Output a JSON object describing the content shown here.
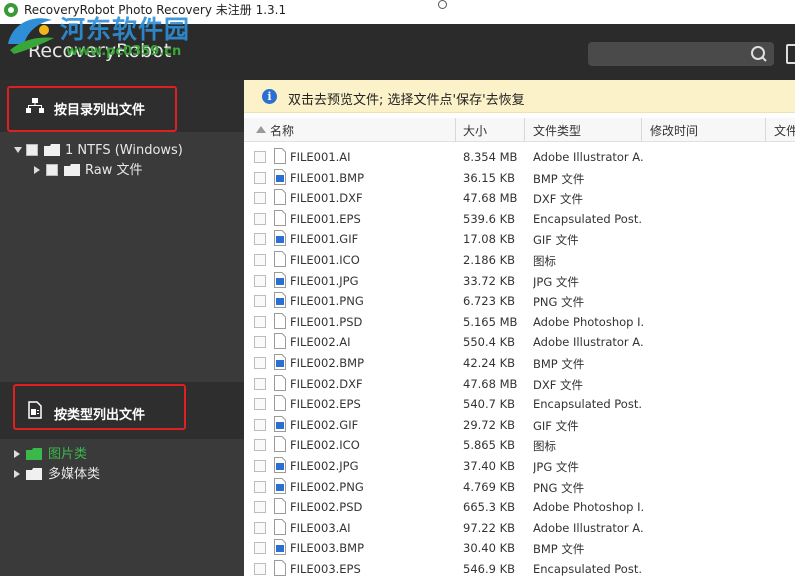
{
  "window": {
    "title": "RecoveryRobot Photo Recovery 未注册 1.3.1"
  },
  "watermark": {
    "text_cn": "河东软件园",
    "text_url": "www.pc0359.cn"
  },
  "header": {
    "brand": "RecoveryRobot",
    "search_placeholder": ""
  },
  "sidebar": {
    "by_directory_label": "按目录列出文件",
    "by_type_label": "按类型列出文件",
    "dir_tree": [
      {
        "label": "1 NTFS (Windows)"
      },
      {
        "label": "Raw 文件"
      }
    ],
    "type_tree": [
      {
        "label": "图片类"
      },
      {
        "label": "多媒体类"
      }
    ]
  },
  "info_bar": {
    "text": "双击去预览文件; 选择文件点'保存'去恢复"
  },
  "columns": {
    "name": "名称",
    "size": "大小",
    "type": "文件类型",
    "modified": "修改时间",
    "extra": "文件"
  },
  "files": [
    {
      "name": "FILE001.AI",
      "size": "8.354 MB",
      "type": "Adobe Illustrator A...",
      "icon": "doc-icon"
    },
    {
      "name": "FILE001.BMP",
      "size": "36.15 KB",
      "type": "BMP 文件",
      "icon": "image-file-icon"
    },
    {
      "name": "FILE001.DXF",
      "size": "47.68 MB",
      "type": "DXF 文件",
      "icon": "doc-icon"
    },
    {
      "name": "FILE001.EPS",
      "size": "539.6 KB",
      "type": "Encapsulated Post...",
      "icon": "doc-icon"
    },
    {
      "name": "FILE001.GIF",
      "size": "17.08 KB",
      "type": "GIF 文件",
      "icon": "image-file-icon"
    },
    {
      "name": "FILE001.ICO",
      "size": "2.186 KB",
      "type": "图标",
      "icon": "doc-icon"
    },
    {
      "name": "FILE001.JPG",
      "size": "33.72 KB",
      "type": "JPG 文件",
      "icon": "image-file-icon"
    },
    {
      "name": "FILE001.PNG",
      "size": "6.723 KB",
      "type": "PNG 文件",
      "icon": "image-file-icon"
    },
    {
      "name": "FILE001.PSD",
      "size": "5.165 MB",
      "type": "Adobe Photoshop I...",
      "icon": "doc-icon"
    },
    {
      "name": "FILE002.AI",
      "size": "550.4 KB",
      "type": "Adobe Illustrator A...",
      "icon": "doc-icon"
    },
    {
      "name": "FILE002.BMP",
      "size": "42.24 KB",
      "type": "BMP 文件",
      "icon": "image-file-icon"
    },
    {
      "name": "FILE002.DXF",
      "size": "47.68 MB",
      "type": "DXF 文件",
      "icon": "doc-icon"
    },
    {
      "name": "FILE002.EPS",
      "size": "540.7 KB",
      "type": "Encapsulated Post...",
      "icon": "doc-icon"
    },
    {
      "name": "FILE002.GIF",
      "size": "29.72 KB",
      "type": "GIF 文件",
      "icon": "image-file-icon"
    },
    {
      "name": "FILE002.ICO",
      "size": "5.865 KB",
      "type": "图标",
      "icon": "doc-icon"
    },
    {
      "name": "FILE002.JPG",
      "size": "37.40 KB",
      "type": "JPG 文件",
      "icon": "image-file-icon"
    },
    {
      "name": "FILE002.PNG",
      "size": "4.769 KB",
      "type": "PNG 文件",
      "icon": "image-file-icon"
    },
    {
      "name": "FILE002.PSD",
      "size": "665.3 KB",
      "type": "Adobe Photoshop I...",
      "icon": "doc-icon"
    },
    {
      "name": "FILE003.AI",
      "size": "97.22 KB",
      "type": "Adobe Illustrator A...",
      "icon": "doc-icon"
    },
    {
      "name": "FILE003.BMP",
      "size": "30.40 KB",
      "type": "BMP 文件",
      "icon": "image-file-icon"
    },
    {
      "name": "FILE003.EPS",
      "size": "546.9 KB",
      "type": "Encapsulated Post...",
      "icon": "doc-icon"
    }
  ],
  "colors": {
    "header_bg": "#2b2b2b",
    "sidebar_bg": "#3a3a3a",
    "info_bar_bg": "#fbf2c9",
    "highlight_border": "#e02020",
    "folder_green": "#3bb84a"
  }
}
